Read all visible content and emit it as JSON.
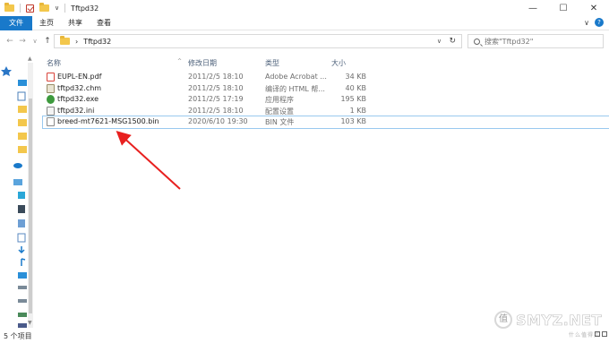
{
  "window": {
    "title": "Tftpd32",
    "controls": {
      "minimize": "—",
      "maximize": "☐",
      "close": "✕"
    }
  },
  "ribbon": {
    "tabs": [
      {
        "label": "文件",
        "active": true
      },
      {
        "label": "主页"
      },
      {
        "label": "共享"
      },
      {
        "label": "查看"
      }
    ],
    "right_chevron": "∨",
    "help": "?"
  },
  "nav": {
    "back": "←",
    "forward": "→",
    "up_history": "∨",
    "up": "↑"
  },
  "address": {
    "separator": "›",
    "path": "Tftpd32",
    "dropdown": "∨",
    "refresh": "↻"
  },
  "search": {
    "placeholder": "搜索\"Tftpd32\""
  },
  "columns": {
    "name": "名称",
    "modified": "修改日期",
    "type": "类型",
    "size": "大小",
    "sort_indicator": "^"
  },
  "files": [
    {
      "name": "EUPL-EN.pdf",
      "modified": "2011/2/5 18:10",
      "type": "Adobe Acrobat ...",
      "size": "34 KB",
      "icon": "pdf-icon"
    },
    {
      "name": "tftpd32.chm",
      "modified": "2011/2/5 18:10",
      "type": "编译的 HTML 帮...",
      "size": "40 KB",
      "icon": "chm-icon"
    },
    {
      "name": "tftpd32.exe",
      "modified": "2011/2/5 17:19",
      "type": "应用程序",
      "size": "195 KB",
      "icon": "exe-icon"
    },
    {
      "name": "tftpd32.ini",
      "modified": "2011/2/5 18:10",
      "type": "配置设置",
      "size": "1 KB",
      "icon": "ini-icon"
    },
    {
      "name": "breed-mt7621-MSG1500.bin",
      "modified": "2020/6/10 19:30",
      "type": "BIN 文件",
      "size": "103 KB",
      "icon": "bin-icon",
      "selected": true
    }
  ],
  "status": {
    "count": "5 个项目"
  },
  "watermark": {
    "brand": "SMYZ.NET",
    "badge": "值",
    "sub": "什么值得买"
  },
  "colors": {
    "accent": "#1979ca",
    "arrow": "#e8201f",
    "folder": "#f3c74c"
  }
}
